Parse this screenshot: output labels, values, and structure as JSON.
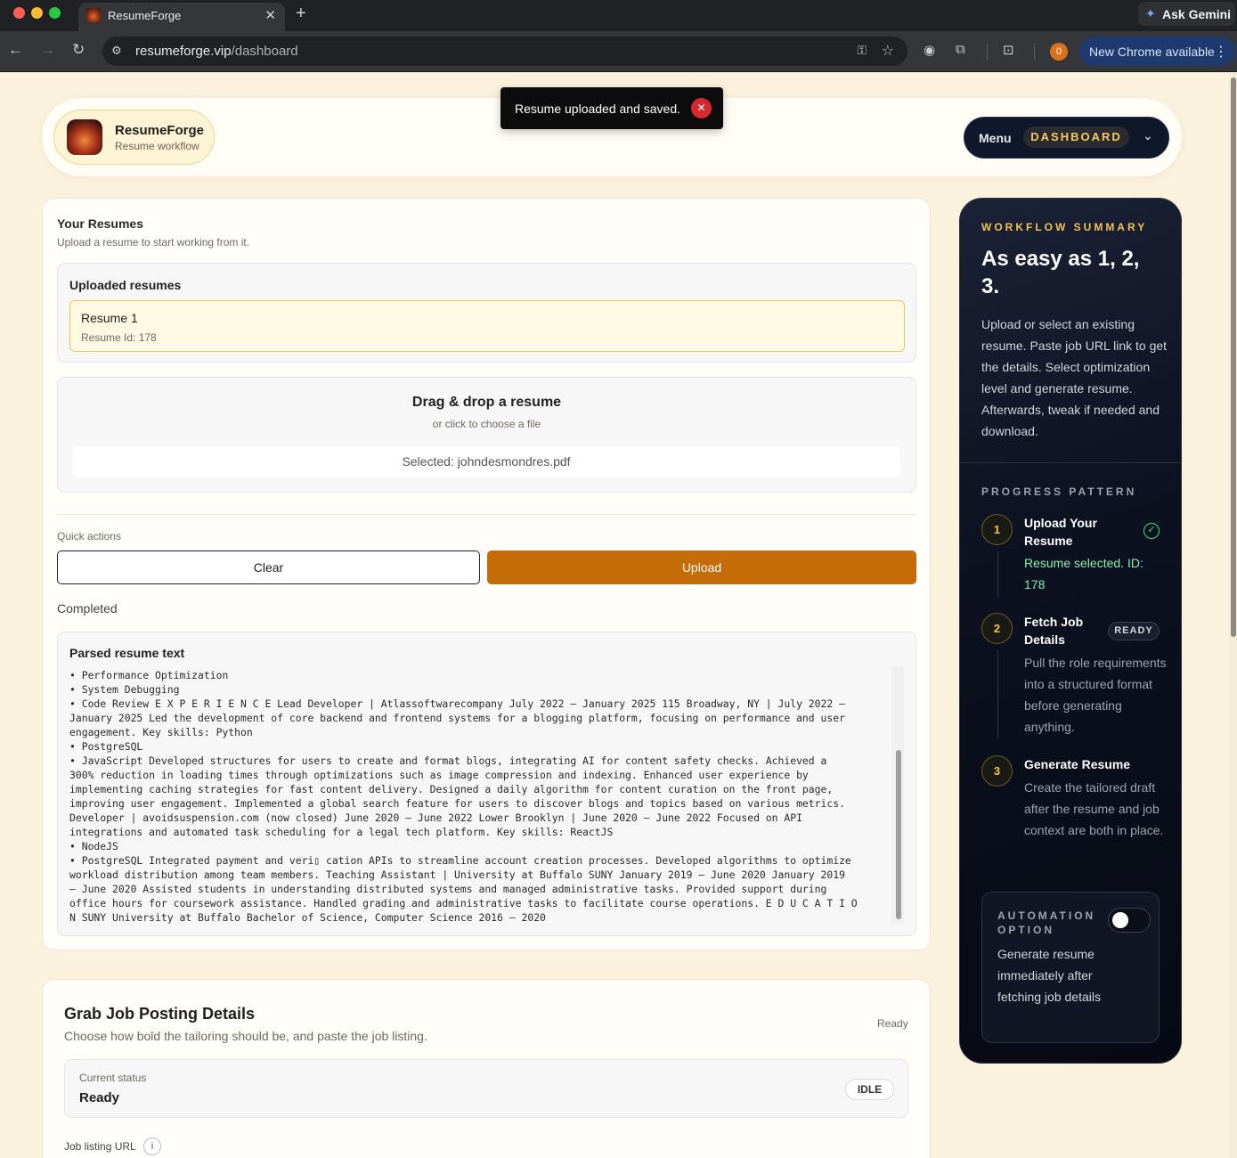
{
  "browser": {
    "tab_title": "ResumeForge",
    "url_domain": "resumeforge.vip",
    "url_path": "/dashboard",
    "gemini_label": "Ask Gemini",
    "update_label": "New Chrome available",
    "notif_count": "0"
  },
  "header": {
    "brand_name": "ResumeForge",
    "brand_subtitle": "Resume workflow",
    "menu_label": "Menu",
    "menu_current": "DASHBOARD"
  },
  "toast": {
    "message": "Resume uploaded and saved."
  },
  "resumes": {
    "title": "Your Resumes",
    "subtitle": "Upload a resume to start working from it.",
    "uploaded_title": "Uploaded resumes",
    "items": [
      {
        "name": "Resume 1",
        "id_label": "Resume Id: 178"
      }
    ],
    "dropzone_title": "Drag & drop a resume",
    "dropzone_subtitle": "or click to choose a file",
    "selected_file": "Selected: johndesmondres.pdf",
    "quick_actions_label": "Quick actions",
    "clear_label": "Clear",
    "upload_label": "Upload",
    "status": "Completed",
    "parsed_title": "Parsed resume text",
    "parsed_text": "• Performance Optimization\n• System Debugging\n• Code Review E X P E R I E N C E Lead Developer | Atlassoftwarecompany July 2022 – January 2025 115 Broadway, NY | July 2022 –\nJanuary 2025 Led the development of core backend and frontend systems for a blogging platform, focusing on performance and user\nengagement. Key skills: Python\n• PostgreSQL\n• JavaScript Developed structures for users to create and format blogs, integrating AI for content safety checks. Achieved a\n300% reduction in loading times through optimizations such as image compression and indexing. Enhanced user experience by\nimplementing caching strategies for fast content delivery. Designed a daily algorithm for content curation on the front page,\nimproving user engagement. Implemented a global search feature for users to discover blogs and topics based on various metrics.\nDeveloper | avoidsuspension.com (now closed) June 2020 – June 2022 Lower Brooklyn | June 2020 – June 2022 Focused on API\nintegrations and automated task scheduling for a legal tech platform. Key skills: ReactJS\n• NodeJS\n• PostgreSQL Integrated payment and veri▯ cation APIs to streamline account creation processes. Developed algorithms to optimize\nworkload distribution among team members. Teaching Assistant | University at Buffalo SUNY January 2019 – June 2020 January 2019\n– June 2020 Assisted students in understanding distributed systems and managed administrative tasks. Provided support during\noffice hours for coursework assistance. Handled grading and administrative tasks to facilitate course operations. E D U C A T I O\nN SUNY University at Buffalo Bachelor of Science, Computer Science 2016 – 2020"
  },
  "job": {
    "title": "Grab Job Posting Details",
    "subtitle": "Choose how bold the tailoring should be, and paste the job listing.",
    "state": "Ready",
    "status_label": "Current status",
    "status_value": "Ready",
    "status_badge": "IDLE",
    "url_label": "Job listing URL",
    "info_glyph": "i"
  },
  "workflow": {
    "eyebrow": "WORKFLOW SUMMARY",
    "heading": "As easy as 1, 2, 3.",
    "body": "Upload or select an existing resume. Paste job URL link to get the details. Select optimization level and generate resume. Afterwards, tweak if needed and download.",
    "progress_eyebrow": "PROGRESS PATTERN",
    "steps": [
      {
        "num": "1",
        "title": "Upload Your Resume",
        "desc": "Resume selected. ID: 178",
        "badge": ""
      },
      {
        "num": "2",
        "title": "Fetch Job Details",
        "desc": "Pull the role requirements into a structured format before generating anything.",
        "badge": "READY"
      },
      {
        "num": "3",
        "title": "Generate Resume",
        "desc": "Create the tailored draft after the resume and job context are both in place.",
        "badge": ""
      }
    ],
    "automation_title": "AUTOMATION OPTION",
    "automation_desc": "Generate resume immediately after fetching job details",
    "automation_enabled": false
  },
  "colors": {
    "accent": "#c46c07",
    "page_bg": "#fbf2dd",
    "panel_bg": "#0c1120",
    "gold": "#f2c14e",
    "success": "#86efac"
  }
}
